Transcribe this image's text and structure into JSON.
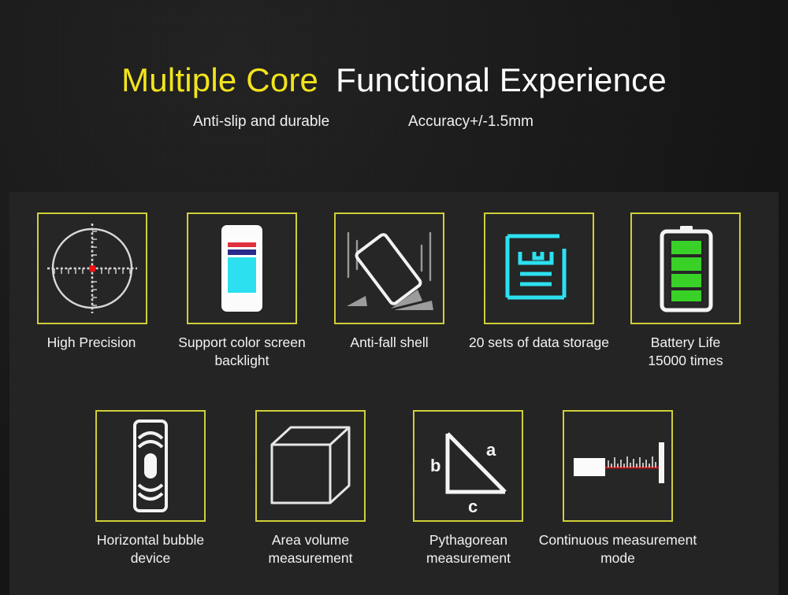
{
  "header": {
    "title_accent": "Multiple Core",
    "title_plain": "Functional Experience",
    "subtitle_left": "Anti-slip and durable",
    "subtitle_right": "Accuracy+/-1.5mm"
  },
  "colors": {
    "background": "#161616",
    "panel": "#232323",
    "accent_yellow": "#f2e41c",
    "box_border": "#cfcf3a",
    "text_white": "#f2f2f2",
    "screen_cyan": "#2ce0f0",
    "battery_green": "#39d127",
    "laser_red": "#b01818",
    "phone_red_bar": "#e03040",
    "phone_blue_bar": "#2a2a8c"
  },
  "features_row1": [
    {
      "id": "high-precision",
      "icon": "crosshair-reticle-icon",
      "label": "High Precision"
    },
    {
      "id": "color-screen-backlight",
      "icon": "phone-color-screen-icon",
      "label": "Support color screen\nbacklight"
    },
    {
      "id": "anti-fall-shell",
      "icon": "drop-resistant-device-icon",
      "label": "Anti-fall shell"
    },
    {
      "id": "data-storage",
      "icon": "floppy-disk-save-icon",
      "label": "20 sets of data storage"
    },
    {
      "id": "battery-life",
      "icon": "battery-full-icon",
      "label": "Battery Life\n15000 times"
    }
  ],
  "features_row2": [
    {
      "id": "horizontal-bubble-device",
      "icon": "bubble-level-icon",
      "label": "Horizontal bubble\ndevice"
    },
    {
      "id": "area-volume-measurement",
      "icon": "wireframe-cube-icon",
      "label": "Area volume\nmeasurement"
    },
    {
      "id": "pythagorean-measurement",
      "icon": "right-triangle-icon",
      "label": "Pythagorean\nmeasurement",
      "triangle_labels": {
        "hypotenuse": "a",
        "vertical": "b",
        "base": "c"
      }
    },
    {
      "id": "continuous-measurement-mode",
      "icon": "laser-ruler-icon",
      "label": "Continuous measurement\nmode"
    }
  ]
}
